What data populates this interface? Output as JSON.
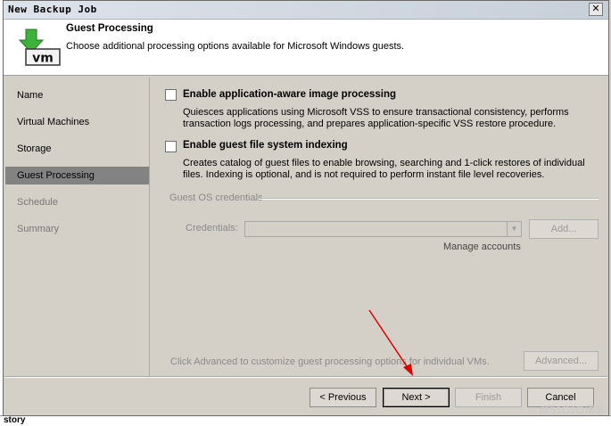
{
  "window": {
    "title": "New Backup Job"
  },
  "header": {
    "title": "Guest Processing",
    "subtitle": "Choose additional processing options available for Microsoft Windows guests.",
    "icon": "vm-download-icon"
  },
  "steps": [
    {
      "label": "Name",
      "active": false
    },
    {
      "label": "Virtual Machines",
      "active": false
    },
    {
      "label": "Storage",
      "active": false
    },
    {
      "label": "Guest Processing",
      "active": true
    },
    {
      "label": "Schedule",
      "active": false
    },
    {
      "label": "Summary",
      "active": false
    }
  ],
  "options": {
    "app_aware": {
      "label": "Enable application-aware image processing",
      "checked": false,
      "desc_line1": "Quiesces applications using Microsoft VSS to ensure transactional consistency, performs",
      "desc_line2": "transaction logs processing, and prepares application-specific VSS restore procedure."
    },
    "indexing": {
      "label": "Enable guest file system indexing",
      "checked": false,
      "desc_line1": "Creates catalog of guest files to enable browsing, searching and 1-click restores of individual",
      "desc_line2": "files. Indexing is optional, and is not required to perform instant file level recoveries."
    }
  },
  "credentials": {
    "group_label": "Guest OS credentials",
    "label": "Credentials:",
    "value": "",
    "add_label": "Add...",
    "manage_label": "Manage accounts"
  },
  "advanced": {
    "note": "Click Advanced to customize guest processing options for individual VMs.",
    "button_label": "Advanced..."
  },
  "footer": {
    "previous_label": "< Previous",
    "next_label": "Next >",
    "finish_label": "Finish",
    "cancel_label": "Cancel"
  },
  "background": {
    "bottom_text": "story",
    "watermark": "@51CTO博客"
  },
  "colors": {
    "annotation_arrow": "#e00000",
    "active_step": "#838383"
  }
}
